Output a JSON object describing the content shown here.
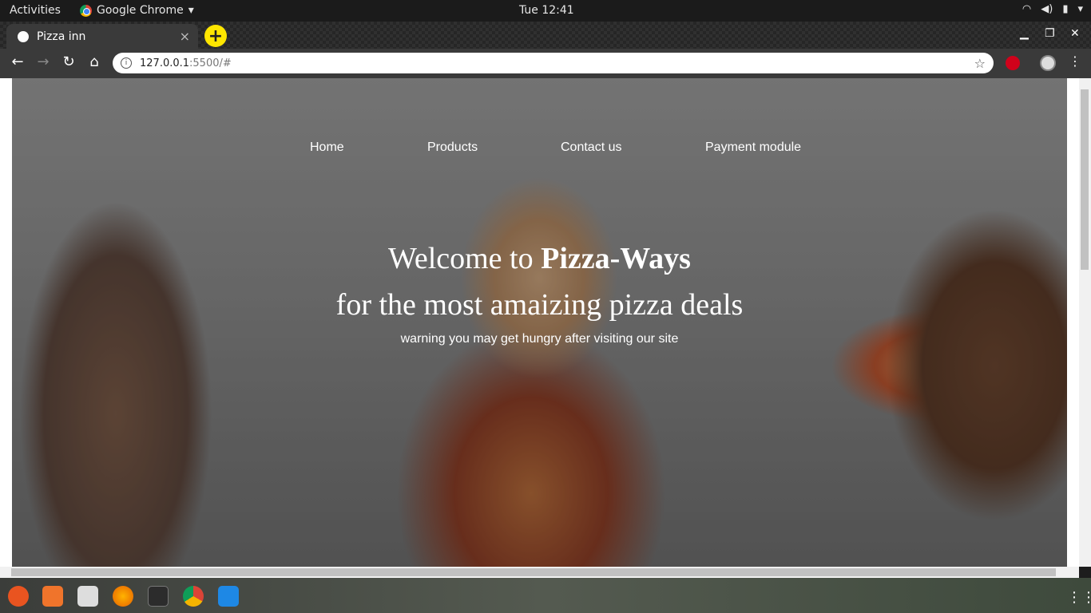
{
  "system_bar": {
    "activities": "Activities",
    "app_name": "Google Chrome",
    "clock": "Tue 12:41"
  },
  "browser": {
    "tab_title": "Pizza inn",
    "url_host": "127.0.0.1",
    "url_path": ":5500/#"
  },
  "page": {
    "nav": [
      "Home",
      "Products",
      "Contact us",
      "Payment module"
    ],
    "headline_prefix": "Welcome to ",
    "headline_brand": "Pizza-Ways",
    "headline_line2": "for the most amaizing pizza deals",
    "subtitle": "warning you may get hungry after visiting our site"
  },
  "colors": {
    "new_tab_button": "#ffe600",
    "toolbar": "#3a3a3a"
  }
}
